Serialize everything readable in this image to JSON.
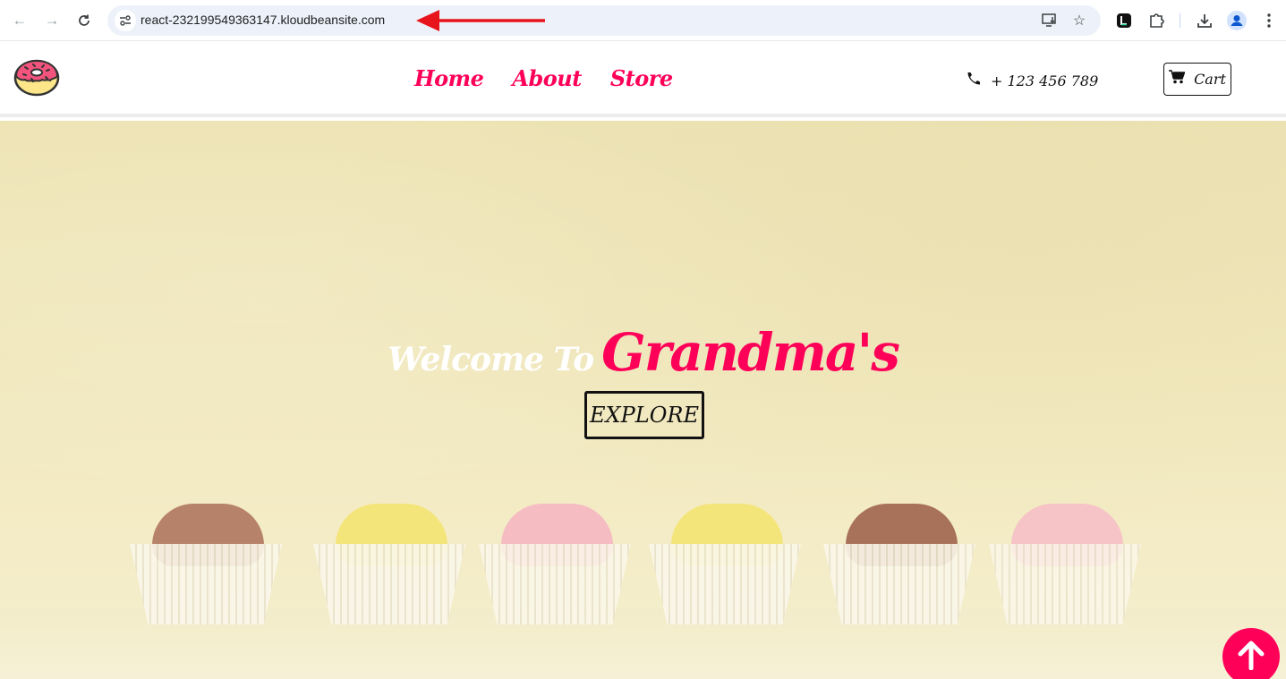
{
  "browser": {
    "url": "react-232199549363147.kloudbeansite.com",
    "nav_icons": [
      "back-arrow-icon",
      "forward-arrow-icon",
      "reload-icon"
    ],
    "omnibox_icons": [
      "site-info-icon",
      "install-app-icon",
      "bookmark-star-icon"
    ],
    "toolbar_icons": [
      "extension-l-icon",
      "extensions-puzzle-icon",
      "download-icon",
      "profile-avatar-icon",
      "more-menu-icon"
    ],
    "annotation": "red-arrow-pointing-to-url"
  },
  "header": {
    "logo": "donut-logo",
    "menu": [
      {
        "label": "Home"
      },
      {
        "label": "About"
      },
      {
        "label": "Store"
      }
    ],
    "phone": "+ 123 456 789",
    "cart_label": "Cart"
  },
  "hero": {
    "welcome_text": "Welcome To",
    "brand_text": "Grandma's",
    "explore_label": "EXPLORE",
    "background": "cupcakes-photo"
  },
  "colors": {
    "accent": "#ff0059",
    "text_dark": "#111111",
    "hero_bg": "#f1e8bd"
  },
  "scroll_to_top_icon": "arrow-up-icon"
}
